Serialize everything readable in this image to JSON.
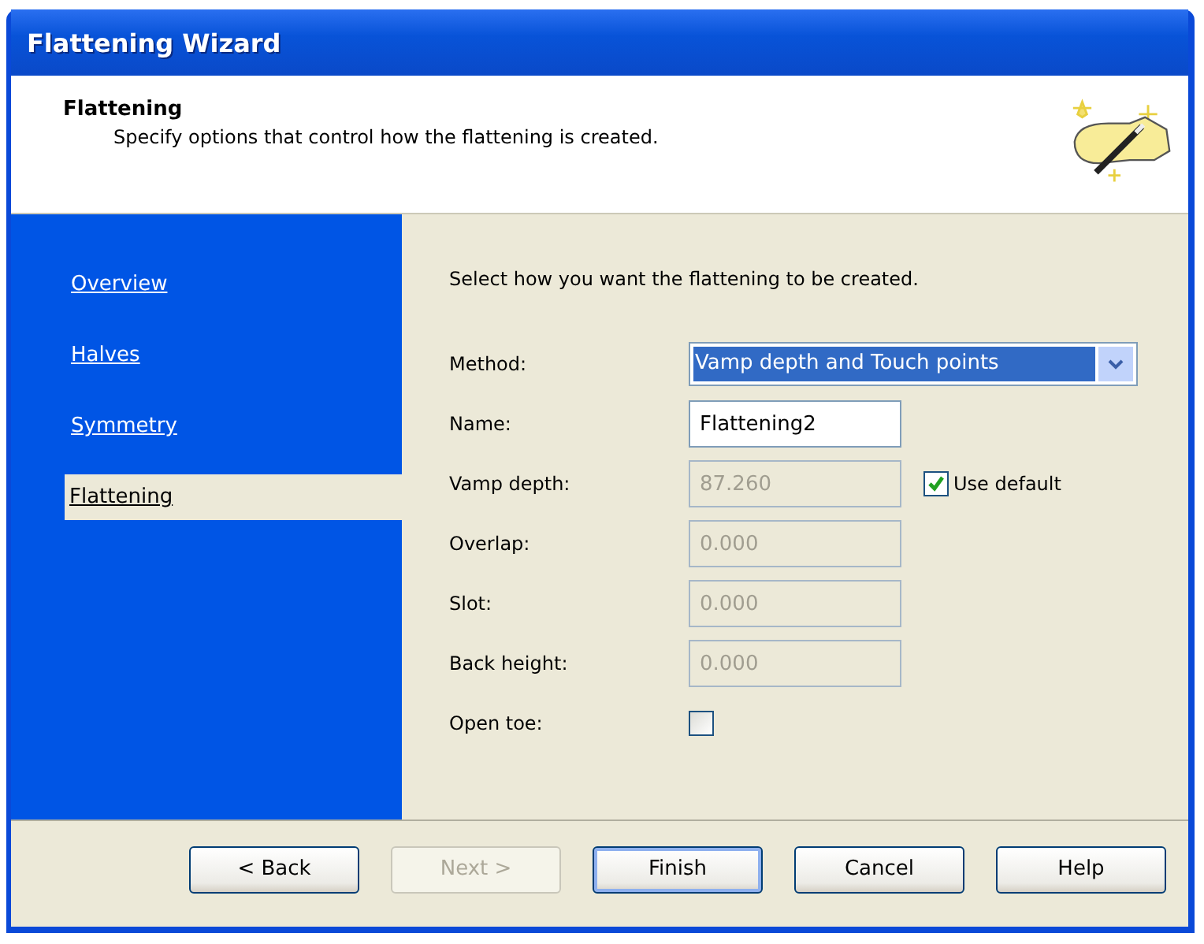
{
  "window": {
    "title": "Flattening Wizard"
  },
  "header": {
    "title": "Flattening",
    "subtitle": "Specify options that control how the flattening is created."
  },
  "sidebar": {
    "items": [
      {
        "label": "Overview",
        "selected": false
      },
      {
        "label": "Halves",
        "selected": false
      },
      {
        "label": "Symmetry",
        "selected": false
      },
      {
        "label": "Flattening",
        "selected": true
      }
    ]
  },
  "content": {
    "intro": "Select how you want the flattening to be created.",
    "fields": [
      {
        "kind": "combo",
        "label": "Method:",
        "value": "Vamp depth and Touch points"
      },
      {
        "kind": "text",
        "label": "Name:",
        "value": "Flattening2",
        "disabled": false
      },
      {
        "kind": "text",
        "label": "Vamp depth:",
        "value": "87.260",
        "disabled": true,
        "option": {
          "label": "Use default",
          "checked": true
        }
      },
      {
        "kind": "text",
        "label": "Overlap:",
        "value": "0.000",
        "disabled": true
      },
      {
        "kind": "text",
        "label": "Slot:",
        "value": "0.000",
        "disabled": true
      },
      {
        "kind": "text",
        "label": "Back height:",
        "value": "0.000",
        "disabled": true
      },
      {
        "kind": "check",
        "label": "Open toe:",
        "checked": false
      }
    ]
  },
  "buttons": [
    {
      "label": "< Back",
      "disabled": false,
      "default": false
    },
    {
      "label": "Next >",
      "disabled": true,
      "default": false
    },
    {
      "label": "Finish",
      "disabled": false,
      "default": true
    },
    {
      "label": "Cancel",
      "disabled": false,
      "default": false
    },
    {
      "label": "Help",
      "disabled": false,
      "default": false
    }
  ]
}
